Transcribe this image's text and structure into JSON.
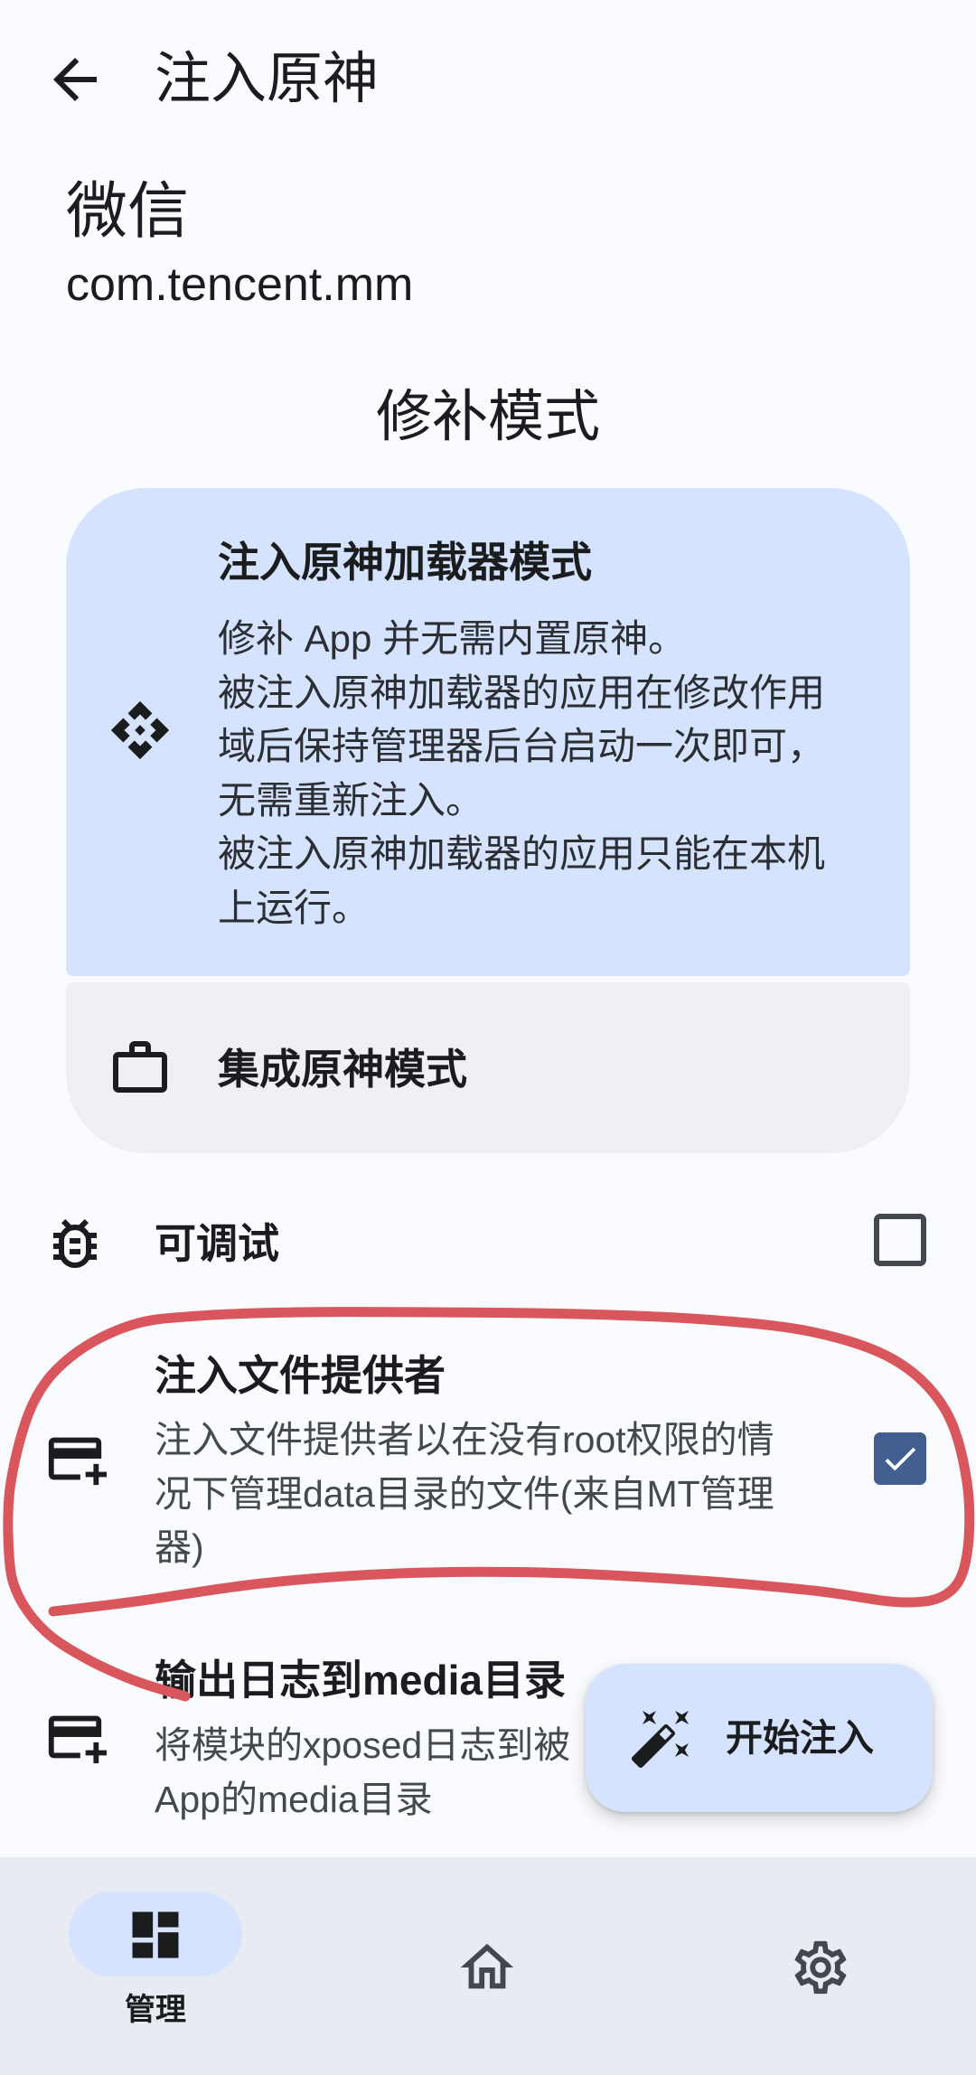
{
  "header": {
    "title": "注入原神",
    "back_icon": "arrow-back-icon"
  },
  "app": {
    "name": "微信",
    "package": "com.tencent.mm"
  },
  "patch_mode": {
    "heading": "修补模式",
    "options": [
      {
        "icon": "api-icon",
        "title": "注入原神加载器模式",
        "selected": true,
        "description_lines": [
          "修补 App 并无需内置原神。",
          "被注入原神加载器的应用在修改作用",
          "域后保持管理器后台启动一次即可，",
          "无需重新注入。",
          "被注入原神加载器的应用只能在本机",
          "上运行。"
        ]
      },
      {
        "icon": "briefcase-icon",
        "title": "集成原神模式",
        "selected": false
      }
    ]
  },
  "settings": [
    {
      "icon": "bug-icon",
      "title": "可调试",
      "checked": false
    },
    {
      "icon": "add-card-icon",
      "title": "注入文件提供者",
      "checked": true,
      "description_lines": [
        "注入文件提供者以在没有root权限的情",
        "况下管理data目录的文件(来自MT管理",
        "器)"
      ]
    },
    {
      "icon": "add-card-icon",
      "title": "输出日志到media目录",
      "description_lines": [
        "将模块的xposed日志到被",
        "App的media目录"
      ]
    }
  ],
  "fab": {
    "icon": "magic-wand-icon",
    "label": "开始注入"
  },
  "bottom_nav": {
    "items": [
      {
        "icon": "dashboard-icon",
        "label": "管理",
        "selected": true
      },
      {
        "icon": "home-icon",
        "selected": false
      },
      {
        "icon": "settings-icon",
        "selected": false
      }
    ]
  },
  "colors": {
    "background": "#fafbff",
    "selected_card": "#d6e3ff",
    "unselected_card": "#eff0f5",
    "checkbox_checked": "#415f91",
    "nav_bar": "#e8ebf2",
    "fab": "#d6e3ff",
    "annotation_ink": "#d9565c"
  }
}
